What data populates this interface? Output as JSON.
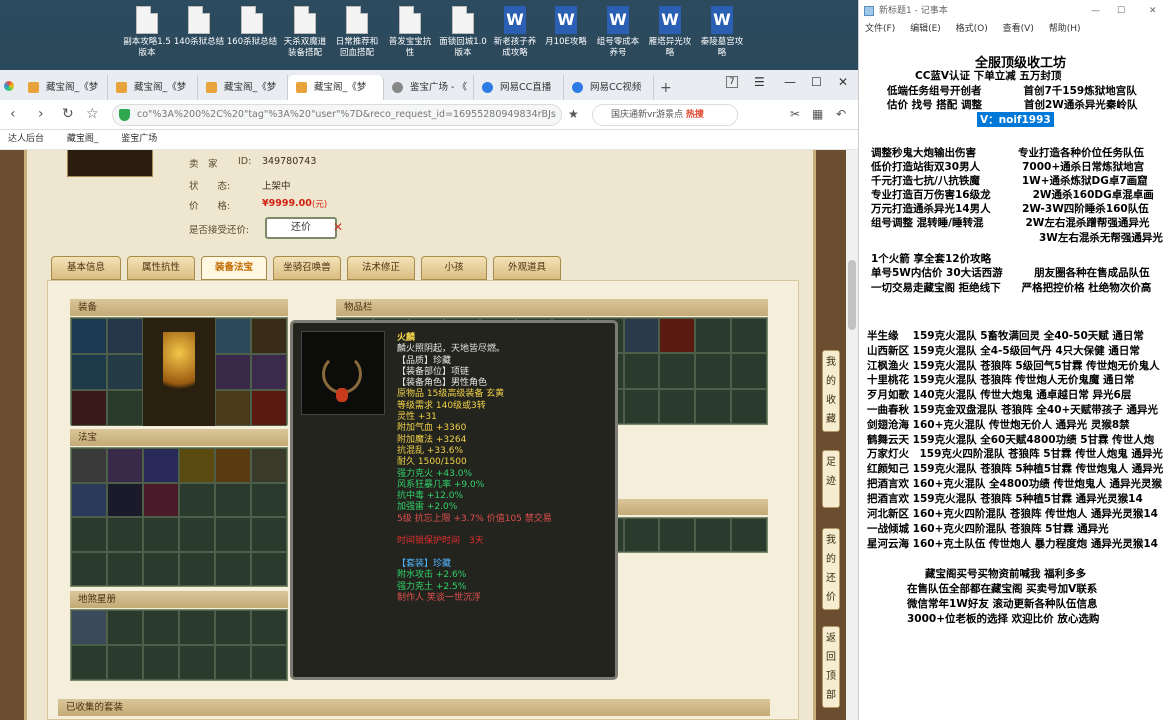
{
  "desktop": {
    "icons": [
      {
        "label": "副本攻略1.5\n版本",
        "type": "doc"
      },
      {
        "label": "140杀狱总结",
        "type": "doc"
      },
      {
        "label": "160杀狱总结",
        "type": "doc"
      },
      {
        "label": "天杀双魔道\n装备搭配",
        "type": "doc"
      },
      {
        "label": "日常推荐和\n回血搭配",
        "type": "doc"
      },
      {
        "label": "普发宝宝抗\n性",
        "type": "doc"
      },
      {
        "label": "面锁回城1.0\n版本",
        "type": "doc"
      },
      {
        "label": "新老孩子养\n成攻略",
        "type": "word"
      },
      {
        "label": "月10E攻略",
        "type": "word"
      },
      {
        "label": "组号零成本\n养号",
        "type": "word"
      },
      {
        "label": "雁塔异光攻\n略",
        "type": "word"
      },
      {
        "label": "秦陵墓宫攻\n略",
        "type": "word"
      }
    ]
  },
  "browser": {
    "tabs": [
      {
        "label": "藏宝阁_《梦",
        "active": false
      },
      {
        "label": "藏宝阁_《梦",
        "active": false
      },
      {
        "label": "藏宝阁_《梦",
        "active": false
      },
      {
        "label": "藏宝阁_《梦",
        "active": true
      },
      {
        "label": "鉴宝广场 - 《",
        "active": false
      },
      {
        "label": "网易CC直播",
        "active": false
      },
      {
        "label": "网易CC视频",
        "active": false
      }
    ],
    "tab_count": "7",
    "url": "co\"%3A%200%2C%20\"tag\"%3A%20\"user\"%7D&reco_request_id=16955280949834rBJs",
    "search_text": "国庆通新vr游景点",
    "search_hot": "热搜",
    "bookmarks": [
      "达人后台",
      "藏宝阁_",
      "鉴宝广场"
    ]
  },
  "listing": {
    "seller_label": "卖　家",
    "id_label": "ID:",
    "id_value": "349780743",
    "status_label": "状　　态:",
    "status_value": "上架中",
    "price_label": "价　　格:",
    "price_value": "¥9999.00",
    "price_unit": "(元)",
    "counter_label": "是否接受还价:",
    "counter_button": "还价"
  },
  "page_tabs": [
    "基本信息",
    "属性抗性",
    "装备法宝",
    "坐骑召唤兽",
    "法术修正",
    "小孩",
    "外观道具"
  ],
  "active_tab": "装备法宝",
  "sections": {
    "equip": "装备",
    "items": "物品栏",
    "fabao": "法宝",
    "ground": "地煞星册",
    "collected": "已收集的套装"
  },
  "tooltip": {
    "name": "火麟",
    "lines": [
      {
        "text": "麟火照阴起，天地皆尽燃。",
        "color": "#e6e6e6"
      },
      {
        "text": "【品质】珍藏",
        "color": "#e6e6e6"
      },
      {
        "text": "【装备部位】项链",
        "color": "#e6e6e6"
      },
      {
        "text": "【装备角色】男性角色",
        "color": "#e6e6e6"
      },
      {
        "text": "原物品 15级高级装备 玄黄",
        "color": "#f0d24a"
      },
      {
        "text": "等级需求 140级或3转",
        "color": "#f0d24a"
      },
      {
        "text": "灵性 +31",
        "color": "#f0d24a"
      },
      {
        "text": "附加气血 +3360",
        "color": "#f0d24a"
      },
      {
        "text": "附加魔法 +3264",
        "color": "#f0d24a"
      },
      {
        "text": "抗混乱 +33.6%",
        "color": "#f0d24a"
      },
      {
        "text": "耐久 1500/1500",
        "color": "#f0d24a"
      },
      {
        "text": "强力克火 +43.0%",
        "color": "#2fd26b"
      },
      {
        "text": "风系狂暴几率 +9.0%",
        "color": "#2fd26b"
      },
      {
        "text": "抗中毒 +12.0%",
        "color": "#2fd26b"
      },
      {
        "text": "加强雷 +2.0%",
        "color": "#2fd26b"
      },
      {
        "text": "5级 抗忘上限 +3.7% 价值105 禁交易",
        "color": "#e05050"
      },
      {
        "text": "",
        "color": "#e6e6e6"
      },
      {
        "text": "时间锁保护时间　3天",
        "color": "#e03030"
      },
      {
        "text": "",
        "color": "#e6e6e6"
      },
      {
        "text": "【套装】珍藏",
        "color": "#4fb4ff"
      },
      {
        "text": "附水攻击 +2.6%",
        "color": "#2fd26b"
      },
      {
        "text": "强力克土 +2.5%",
        "color": "#2fd26b"
      },
      {
        "text": "制作人 笑谈一世沉浮",
        "color": "#e05050"
      }
    ]
  },
  "side_buttons": [
    {
      "label": "我的收藏"
    },
    {
      "label": "足迹"
    },
    {
      "label": "我的还价"
    },
    {
      "label": "返回顶部"
    }
  ],
  "notepad": {
    "title": "新标题1 - 记事本",
    "menu": [
      "文件(F)",
      "编辑(E)",
      "格式(O)",
      "查看(V)",
      "帮助(H)"
    ],
    "lines": [
      "全服顶级收工坊",
      "CC蓝V认证  下单立减  五万封顶",
      "低端任务组号开创者　　　　首创7千159炼狱地宫队",
      "估价 找号 搭配 调整　　　　首创2W通杀异光秦岭队",
      "V：noif1993",
      "调整秒鬼大炮输出伤害　　　　专业打造各种价位任务队伍",
      "低价打造站街双30男人　　　　7000+通杀日常炼狱地宫",
      "千元打造七抗/八抗铁魔　　　　1W+通杀炼狱DG卓7画窟",
      "专业打造百万伤害16级龙　　　　2W通杀160DG卓混卓画",
      "万元打造通杀异光14男人　　　2W-3W四阶睡杀160队伍",
      "组号调整 混转睡/睡转混　　　　2W左右混杀蹭帮强通异光",
      "3W左右混杀无帮强通异光",
      "1个火箭 享全套12价攻略",
      "单号5W内估价 30大话西游　　　朋友圈各种在售成品队伍",
      "一切交易走藏宝阁 拒绝线下　　严格把控价格 杜绝物次价高",
      "半生缘　 159克火混队 5畜牧满回灵 全40-50天赋 通日常",
      "山西新区 159克火混队 全4-5级回气丹 4只大保健 通日常",
      "江枫渔火 159克火混队 苍狼阵 5级回气5甘霖 传世炮无价鬼人",
      "十里桃花 159克火混队 苍狼阵 传世炮人无价鬼魔 通日常",
      "歹月如歌 140克火混队 传世大炮鬼 通卓越日常 异光6层",
      "一曲春秋 159克金双盘混队 苍狼阵 全40+天赋带孩子 通异光",
      "剑翅沧海 160+克火混队 传世炮无价人 通异光 灵猴8禁",
      "鹤舞云天 159克火混队 全60天赋4800功绩 5甘霖 传世人炮",
      "万家灯火　159克火四阶混队 苍狼阵 5甘霖 传世人炮鬼 通异光",
      "红颜知己 159克火混队 苍狼阵 5种植5甘霖 传世炮鬼人 通异光",
      "把酒言欢 160+克火混队 全4800功绩 传世炮鬼人 通异光灵猴",
      "把酒言欢 159克火混队 苍狼阵 5种植5甘霖 通异光灵猴14",
      "河北新区 160+克火四阶混队 苍狼阵 传世炮人 通异光灵猴14",
      "一战倾城 160+克火四阶混队 苍狼阵 5甘霖 通异光",
      "星河云海 160+克土队伍 传世炮人 暴力程度炮 通异光灵猴14",
      "藏宝阁买号买物资前喊我 福利多多",
      "在售队伍全部都在藏宝阁 买卖号加V联系",
      "微信常年1W好友 滚动更新各种队伍信息",
      "3000+位老板的选择 欢迎比价 放心选购"
    ]
  }
}
